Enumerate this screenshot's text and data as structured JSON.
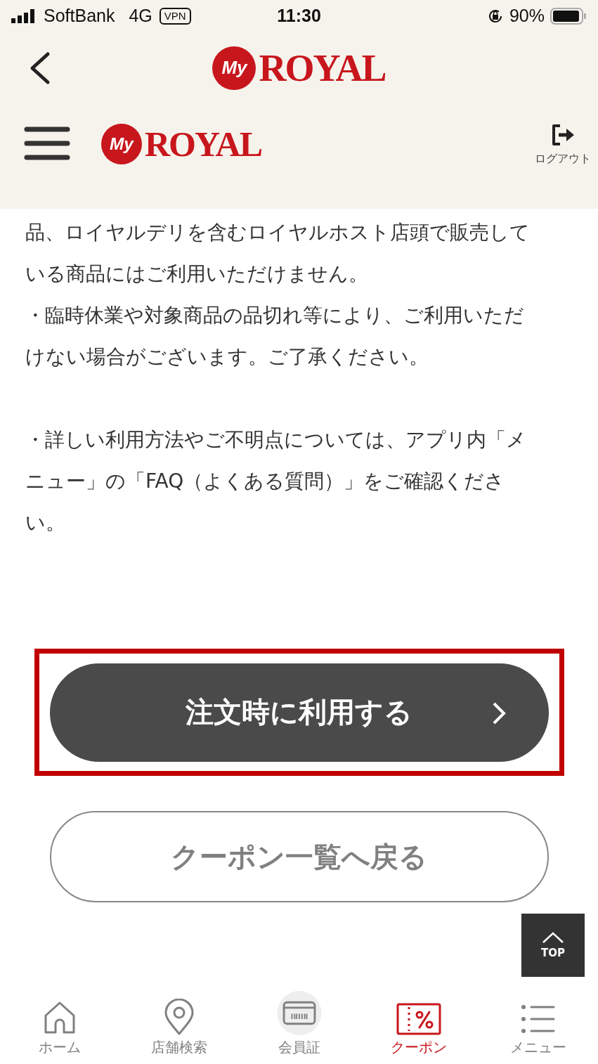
{
  "status_bar": {
    "carrier": "SoftBank",
    "network": "4G",
    "vpn": "VPN",
    "time": "11:30",
    "battery": "90%"
  },
  "nav_bar": {
    "logo_badge": "My",
    "logo_text": "ROYAL"
  },
  "site_header": {
    "logo_badge": "My",
    "logo_text": "ROYAL",
    "logout": "ログアウト"
  },
  "body": [
    "品、ロイヤルデリを含むロイヤルホスト店頭で販売している商品にはご利用いただけません。",
    "・臨時休業や対象商品の品切れ等により、ご利用いただけない場合がございます。ご了承ください。",
    "・詳しい利用方法やご不明点については、アプリ内「メニュー」の「FAQ（よくある質問）」をご確認ください。"
  ],
  "primary_button": {
    "label": "注文時に利用する",
    "highlighted": true
  },
  "secondary_button": {
    "label": "クーポン一覧へ戻る"
  },
  "top_button": {
    "label": "TOP"
  },
  "tabs": [
    {
      "kind": "home",
      "label": "ホーム",
      "selected": false
    },
    {
      "kind": "pin",
      "label": "店舗検索",
      "selected": false
    },
    {
      "kind": "card",
      "label": "会員証",
      "selected": false
    },
    {
      "kind": "coupon",
      "label": "クーポン",
      "selected": true
    },
    {
      "kind": "list",
      "label": "メニュー",
      "selected": false
    }
  ]
}
